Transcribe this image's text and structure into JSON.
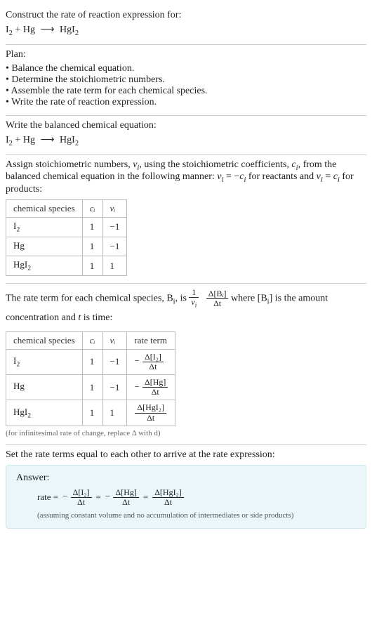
{
  "header": {
    "prompt": "Construct the rate of reaction expression for:"
  },
  "equation": {
    "I2": "I",
    "I2sub": "2",
    "plus": " + ",
    "Hg": "Hg",
    "arrow": "⟶",
    "HgI2_a": "HgI",
    "HgI2_sub": "2"
  },
  "plan": {
    "title": "Plan:",
    "items": [
      "Balance the chemical equation.",
      "Determine the stoichiometric numbers.",
      "Assemble the rate term for each chemical species.",
      "Write the rate of reaction expression."
    ]
  },
  "balanced": {
    "title": "Write the balanced chemical equation:"
  },
  "stoich_text": {
    "part1": "Assign stoichiometric numbers, ",
    "nu_i": "ν",
    "nu_i_sub": "i",
    "part2": ", using the stoichiometric coefficients, ",
    "c_i": "c",
    "c_i_sub": "i",
    "part3": ", from the balanced chemical equation in the following manner: ",
    "rel1_l": "ν",
    "rel1_lsub": "i",
    "rel1_eq": " = −",
    "rel1_r": "c",
    "rel1_rsub": "i",
    "part4": " for reactants and ",
    "rel2_l": "ν",
    "rel2_lsub": "i",
    "rel2_eq": " = ",
    "rel2_r": "c",
    "rel2_rsub": "i",
    "part5": " for products:"
  },
  "table1": {
    "headers": [
      "chemical species",
      "cᵢ",
      "νᵢ"
    ],
    "rows": [
      {
        "species_a": "I",
        "species_sub": "2",
        "c": "1",
        "nu": "−1"
      },
      {
        "species_a": "Hg",
        "species_sub": "",
        "c": "1",
        "nu": "−1"
      },
      {
        "species_a": "HgI",
        "species_sub": "2",
        "c": "1",
        "nu": "1"
      }
    ]
  },
  "rate_term_text": {
    "part1": "The rate term for each chemical species, B",
    "Bi_sub": "i",
    "part2": ", is ",
    "frac1_num": "1",
    "frac1_den_a": "ν",
    "frac1_den_sub": "i",
    "frac2_num": "Δ[Bᵢ]",
    "frac2_den": "Δt",
    "part3": " where [B",
    "part3_sub": "i",
    "part4": "] is the amount concentration and ",
    "t": "t",
    "part5": " is time:"
  },
  "table2": {
    "headers": [
      "chemical species",
      "cᵢ",
      "νᵢ",
      "rate term"
    ],
    "rows": [
      {
        "species_a": "I",
        "species_sub": "2",
        "c": "1",
        "nu": "−1",
        "rate_sign": "−",
        "rate_num": "Δ[I₂]",
        "rate_den": "Δt"
      },
      {
        "species_a": "Hg",
        "species_sub": "",
        "c": "1",
        "nu": "−1",
        "rate_sign": "−",
        "rate_num": "Δ[Hg]",
        "rate_den": "Δt"
      },
      {
        "species_a": "HgI",
        "species_sub": "2",
        "c": "1",
        "nu": "1",
        "rate_sign": "",
        "rate_num": "Δ[HgI₂]",
        "rate_den": "Δt"
      }
    ]
  },
  "note": "(for infinitesimal rate of change, replace Δ with d)",
  "set_equal": "Set the rate terms equal to each other to arrive at the rate expression:",
  "answer": {
    "title": "Answer:",
    "rate_label": "rate =",
    "t1_sign": "−",
    "t1_num": "Δ[I₂]",
    "t1_den": "Δt",
    "eq": "=",
    "t2_sign": "−",
    "t2_num": "Δ[Hg]",
    "t2_den": "Δt",
    "t3_num": "Δ[HgI₂]",
    "t3_den": "Δt",
    "assumption": "(assuming constant volume and no accumulation of intermediates or side products)"
  },
  "chart_data": {
    "type": "table",
    "tables": [
      {
        "title": "stoichiometric numbers",
        "columns": [
          "chemical species",
          "c_i",
          "nu_i"
        ],
        "rows": [
          [
            "I2",
            1,
            -1
          ],
          [
            "Hg",
            1,
            -1
          ],
          [
            "HgI2",
            1,
            1
          ]
        ]
      },
      {
        "title": "rate terms",
        "columns": [
          "chemical species",
          "c_i",
          "nu_i",
          "rate term"
        ],
        "rows": [
          [
            "I2",
            1,
            -1,
            "-Δ[I2]/Δt"
          ],
          [
            "Hg",
            1,
            -1,
            "-Δ[Hg]/Δt"
          ],
          [
            "HgI2",
            1,
            1,
            "Δ[HgI2]/Δt"
          ]
        ]
      }
    ]
  }
}
